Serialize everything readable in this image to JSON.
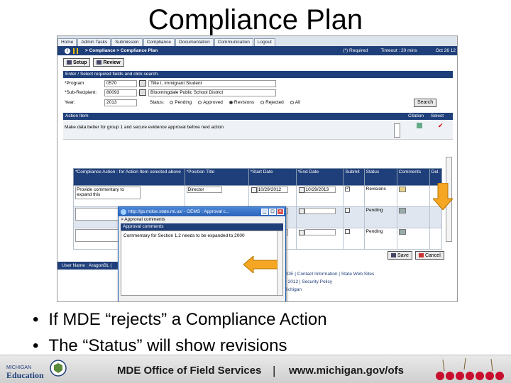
{
  "slide": {
    "title": "Compliance Plan",
    "bullets": [
      "If MDE “rejects” a Compliance Action",
      "The “Status” will show revisions"
    ]
  },
  "app": {
    "nav_tabs": [
      "Home",
      "Admin Tasks",
      "Submission",
      "Compliance",
      "Documentation",
      "Communication",
      "Logout"
    ],
    "breadcrumb": "> Compliance > Compliance Plan",
    "required_label": "(*) Required",
    "timeout": "Timeout : 20 mins",
    "date": "Oct 26 12",
    "toolbar": {
      "setup_label": "Setup",
      "review_label": "Review"
    },
    "form": {
      "instruction": "Enter / Select required fields and click search.",
      "program_label": "*Program",
      "program_code": "0570",
      "program_name": "Title I, Immigrant Student",
      "subrecipient_label": "*Sub-Recipient:",
      "subrecipient_code": "80093",
      "subrecipient_name": "Bloomingdale Public School District",
      "year_label": "Year:",
      "year_value": "2013",
      "status_label": "Status:",
      "status_options": [
        "Pending",
        "Approved",
        "Revisions",
        "Rejected",
        "All"
      ],
      "status_selected": "Revisions",
      "search_label": "Search"
    },
    "action_items": {
      "header": "Action Item",
      "citation_header": "Citation",
      "select_header": "Select",
      "row_text": "Make data better for group 1 and secure evidence approval before next action"
    },
    "compliance_table": {
      "headers": [
        "*Compliance Action : for Action Item selected above",
        "*Position Title",
        "*Start Date",
        "*End Date",
        "Submit",
        "Status",
        "Comments",
        "Del."
      ],
      "rows": [
        {
          "action": "Provide commentary to expand this",
          "position": "Director",
          "start": "10/29/2012",
          "end": "10/29/2013",
          "status": "Revisions"
        },
        {
          "action": "",
          "position": "",
          "start": "",
          "end": "",
          "status": "Pending"
        },
        {
          "action": "",
          "position": "",
          "start": "",
          "end": "",
          "status": "Pending"
        }
      ]
    },
    "buttons": {
      "save_label": "Save",
      "cancel_label": "Cancel"
    },
    "username": "User Name : AragonBL (",
    "footer_links": [
      "MDE | Contact Information | State Web Sites",
      "© 2012 | Security Policy",
      "Michigan"
    ],
    "popup": {
      "title": "http://gs.mdoe.state.mi.us/ - GEMS : Approval c...",
      "subtitle": "> Approval comments",
      "header": "Approval comments",
      "body": "Commentary for Section 1.2 needs to be expanded to 2000"
    }
  },
  "footer": {
    "org": "MDE Office of Field Services",
    "separator": "|",
    "url": "www.michigan.gov/ofs",
    "logo_text_top": "MICHIGAN",
    "logo_text_bottom": "Education"
  },
  "colors": {
    "header_blue": "#1f3f7a",
    "arrow_orange": "#f5a623",
    "popup_blue": "#2a62b8"
  }
}
